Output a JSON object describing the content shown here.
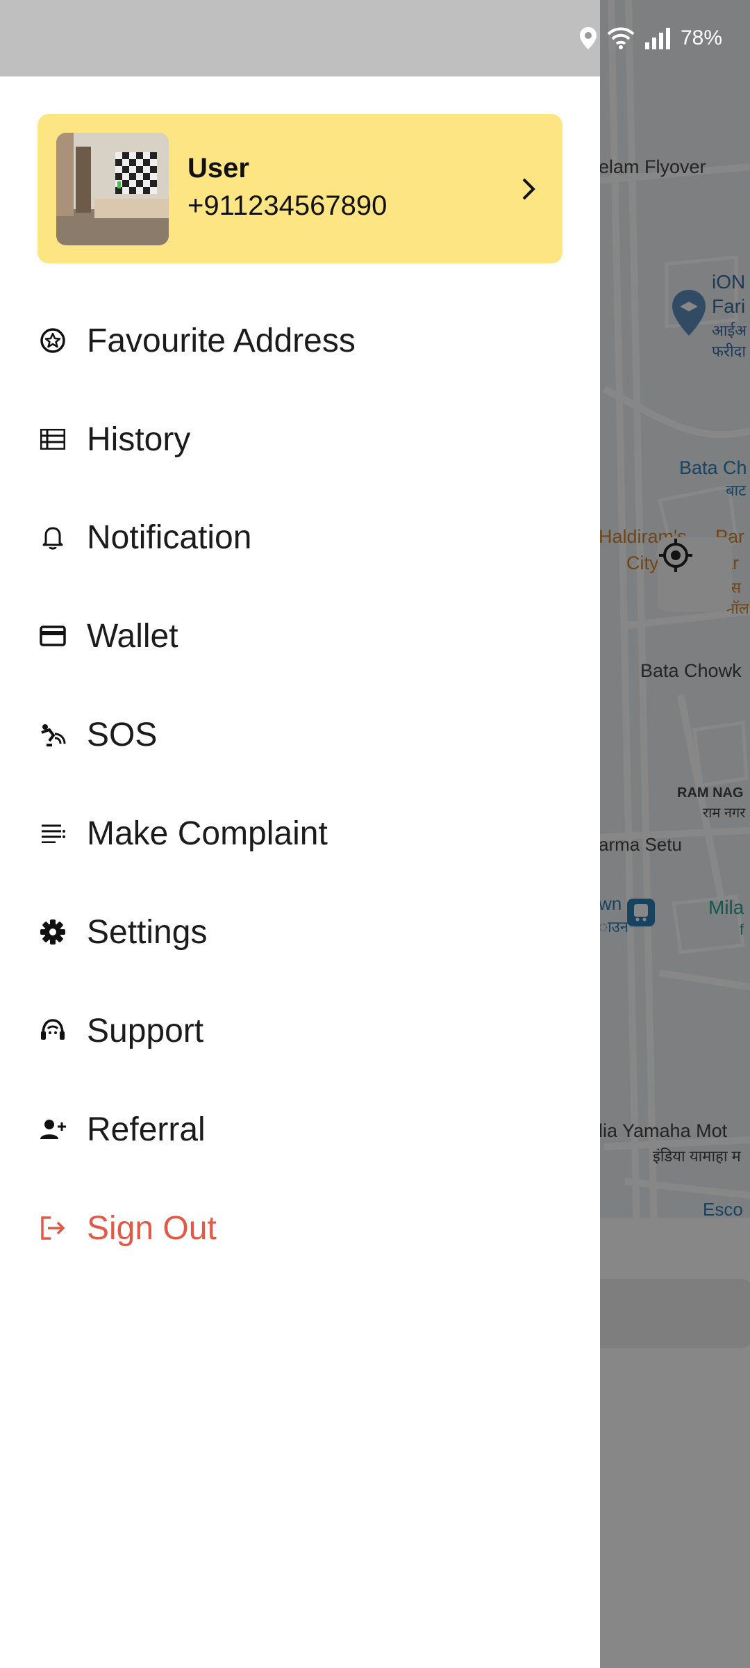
{
  "status_bar": {
    "battery": "78%",
    "icons": [
      "location-icon",
      "wifi-icon",
      "signal-icon"
    ]
  },
  "map": {
    "labels": [
      "elam Flyover",
      "iON",
      "Fari",
      "आईअ",
      "फरीदा",
      "Bata Ch",
      "बाट",
      "Haldiram's",
      "City",
      "Par",
      "ar",
      "म्स",
      "मॉल",
      "Bata Chowk",
      "RAM NAG",
      "राम नगर",
      "arma Setu",
      "wn",
      "ाउन",
      "Mila",
      "f",
      "lia Yamaha Mot",
      "इंडिया यामाहा म",
      "Esco"
    ]
  },
  "profile": {
    "name": "User",
    "phone": "+911234567890"
  },
  "menu": [
    {
      "label": "Favourite Address",
      "icon": "star-circle-icon"
    },
    {
      "label": "History",
      "icon": "list-icon"
    },
    {
      "label": "Notification",
      "icon": "bell-icon"
    },
    {
      "label": "Wallet",
      "icon": "card-icon"
    },
    {
      "label": "SOS",
      "icon": "sos-icon"
    },
    {
      "label": "Make Complaint",
      "icon": "complaint-icon"
    },
    {
      "label": "Settings",
      "icon": "gear-icon"
    },
    {
      "label": "Support",
      "icon": "support-icon"
    },
    {
      "label": "Referral",
      "icon": "add-person-icon"
    },
    {
      "label": "Sign Out",
      "icon": "sign-out-icon"
    }
  ],
  "colors": {
    "profile_card": "#fde584",
    "sign_out": "#e05a47",
    "text": "#1b1b1b"
  }
}
